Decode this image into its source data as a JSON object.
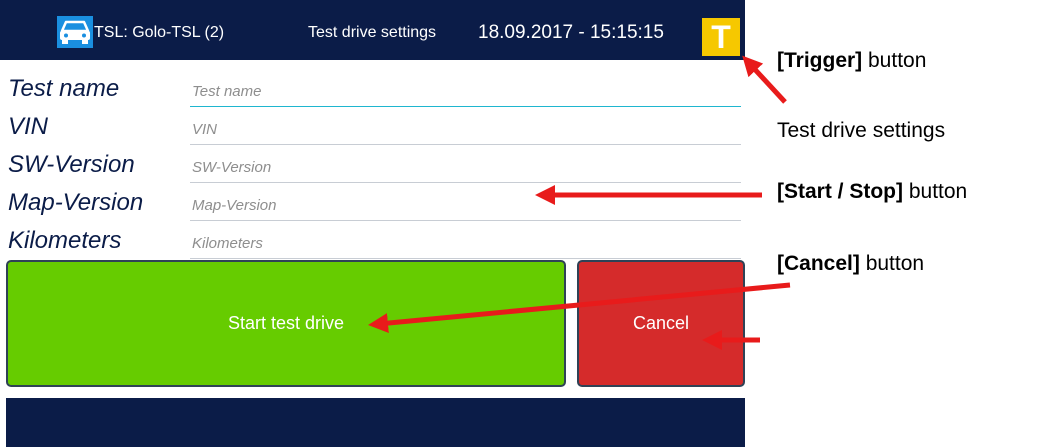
{
  "header": {
    "icon": "car-icon",
    "tsl_label": "TSL: Golo-TSL (2)",
    "title": "Test drive settings",
    "datetime": "18.09.2017 - 15:15:15",
    "trigger_label": "T"
  },
  "form": {
    "fields": [
      {
        "label": "Test name",
        "placeholder": "Test name"
      },
      {
        "label": "VIN",
        "placeholder": "VIN"
      },
      {
        "label": "SW-Version",
        "placeholder": "SW-Version"
      },
      {
        "label": "Map-Version",
        "placeholder": "Map-Version"
      },
      {
        "label": "Kilometers",
        "placeholder": "Kilometers"
      }
    ]
  },
  "buttons": {
    "start_label": "Start test drive",
    "cancel_label": "Cancel"
  },
  "annotations": {
    "trigger": {
      "bold": "[Trigger]",
      "rest": " button"
    },
    "settings": "Test drive settings",
    "start_stop": {
      "bold": "[Start / Stop]",
      "rest": " button"
    },
    "cancel": {
      "bold": "[Cancel]",
      "rest": " button"
    }
  },
  "colors": {
    "topbar": "#0b1c48",
    "car_icon_bg": "#1a8fe0",
    "trigger_bg": "#f6c800",
    "start_bg": "#66cc00",
    "cancel_bg": "#d52b2b",
    "arrow": "#e81b1b"
  }
}
